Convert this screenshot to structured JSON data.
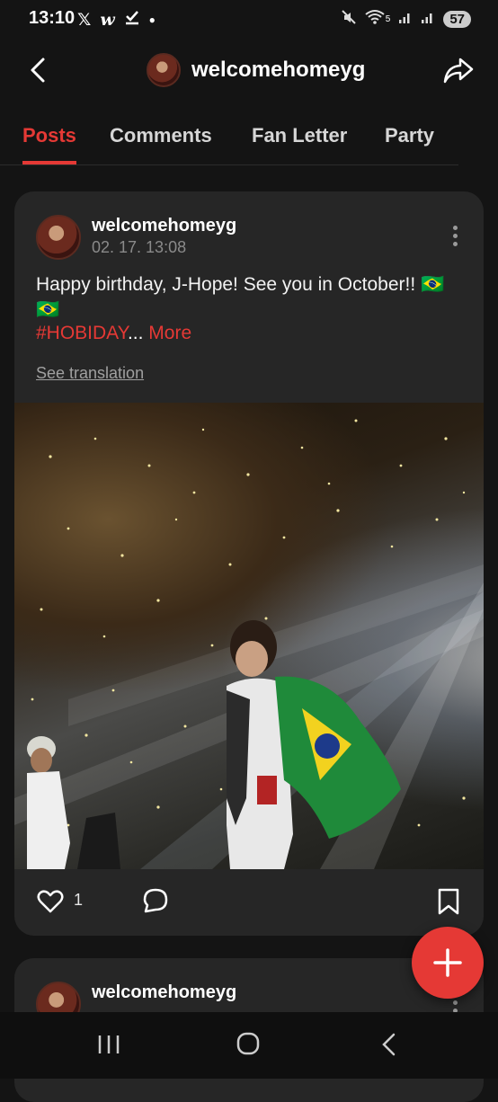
{
  "status_bar": {
    "time": "13:10",
    "left_icons": [
      "x-logo-icon",
      "w-app-icon",
      "check-download-icon",
      "dot-icon"
    ],
    "right_icons": [
      "mute-icon",
      "wifi-icon",
      "signal-icon",
      "signal-icon"
    ],
    "wifi_label": "5",
    "battery": "57"
  },
  "header": {
    "title": "welcomehomeyg",
    "back_icon": "back-arrow-icon",
    "share_icon": "share-icon"
  },
  "tabs": [
    {
      "label": "Posts",
      "active": true
    },
    {
      "label": "Comments",
      "active": false
    },
    {
      "label": "Fan Letter",
      "active": false
    },
    {
      "label": "Party",
      "active": false
    }
  ],
  "posts": [
    {
      "author": "welcomehomeyg",
      "time": "02. 17. 13:08",
      "text": "Happy birthday, J-Hope! See you in October!! 🇧🇷 🇧🇷",
      "hashtag": "#HOBIDAY",
      "ellipsis": "...",
      "more_label": "More",
      "translation_label": "See translation",
      "likes": "1"
    },
    {
      "author": "welcomehomeyg"
    }
  ],
  "colors": {
    "accent": "#e53935",
    "background": "#141414",
    "card": "#262626"
  }
}
